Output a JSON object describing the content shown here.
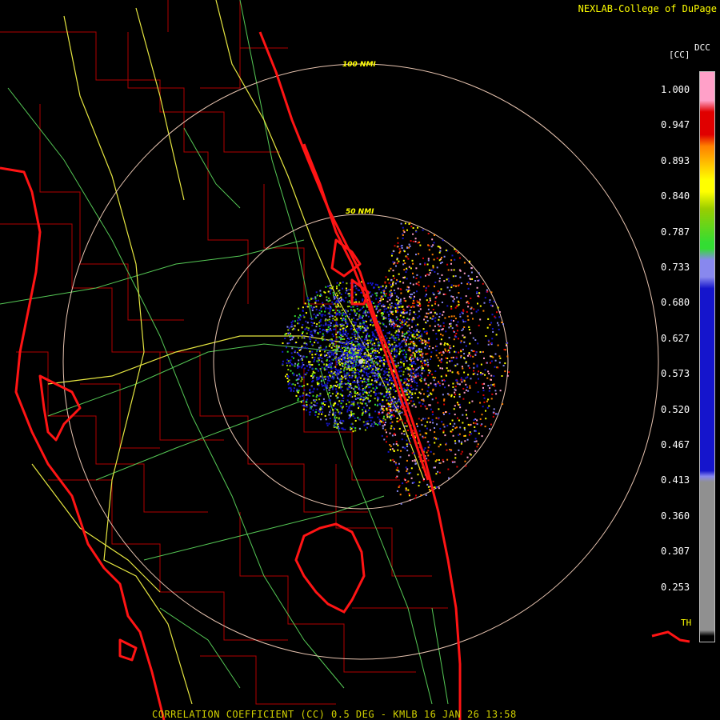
{
  "header": {
    "brand": "NEXLAB-College of DuPage"
  },
  "legend": {
    "title": "DCC",
    "unit": "[CC]",
    "ticks": [
      "1.000",
      "0.947",
      "0.893",
      "0.840",
      "0.787",
      "0.733",
      "0.680",
      "0.627",
      "0.573",
      "0.520",
      "0.467",
      "0.413",
      "0.360",
      "0.307",
      "0.253"
    ],
    "threshold_label": "TH",
    "colors": {
      "pink": "#ffa0c8",
      "red": "#e00000",
      "orange": "#ff8000",
      "yellow": "#ffff00",
      "green": "#33dd33",
      "lavender": "#8888ee",
      "blue": "#1515cc",
      "gray": "#909090"
    }
  },
  "map": {
    "ring_inner_label": "50 NMI",
    "ring_outer_label": "100 NMI",
    "radar_site": "KMLB"
  },
  "footer": {
    "product": "CORRELATION COEFFICIENT (CC) 0.5 DEG - KMLB 16 JAN 26 13:58"
  }
}
